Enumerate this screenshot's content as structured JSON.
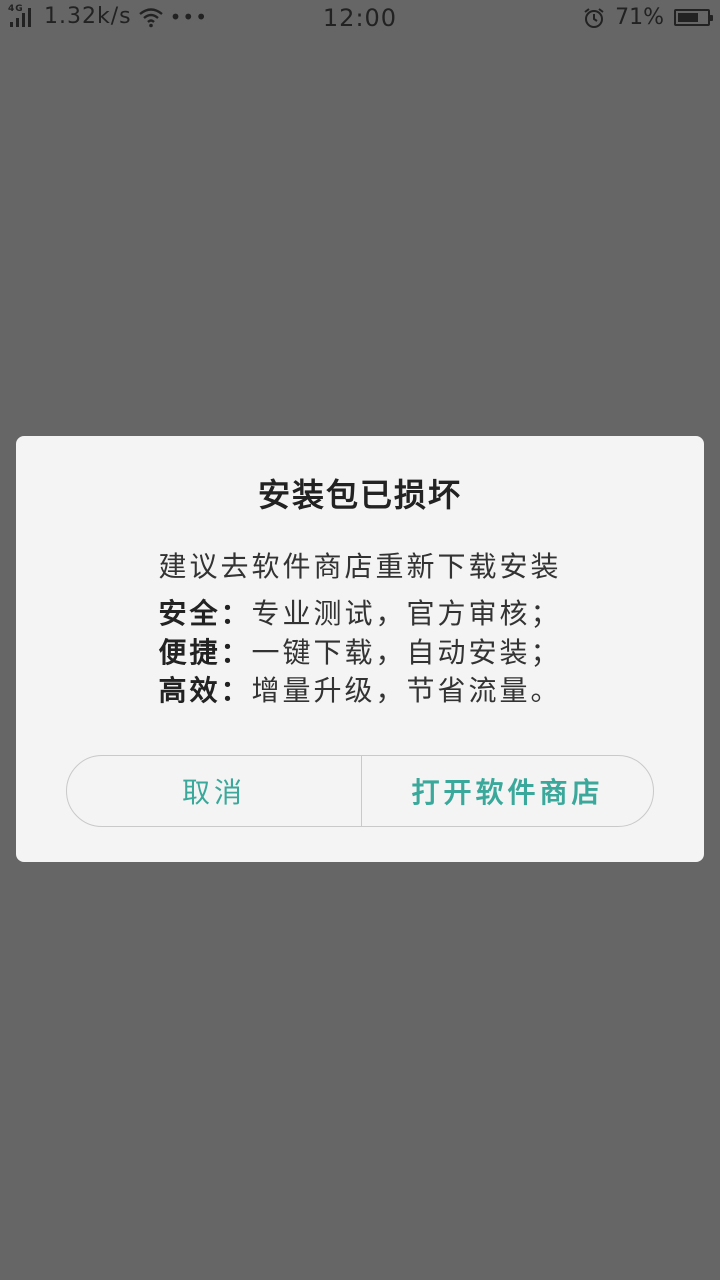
{
  "status_bar": {
    "network_type": "4G",
    "speed": "1.32k/s",
    "more": "•••",
    "time": "12:00",
    "battery_percent_text": "71%",
    "battery_level": 0.71,
    "icons": [
      "signal-icon",
      "wifi-icon",
      "more-icon",
      "alarm-icon",
      "battery-icon"
    ]
  },
  "dialog": {
    "title": "安装包已损坏",
    "subtitle": "建议去软件商店重新下载安装",
    "features": [
      {
        "label": "安全：",
        "text": "专业测试，官方审核；"
      },
      {
        "label": "便捷：",
        "text": "一键下载，自动安装；"
      },
      {
        "label": "高效：",
        "text": "增量升级，节省流量。"
      }
    ],
    "buttons": {
      "cancel": "取消",
      "open_store": "打开软件商店"
    }
  },
  "colors": {
    "background": "#666666",
    "dialog": "#f4f4f4",
    "accent": "#3aa89a"
  }
}
